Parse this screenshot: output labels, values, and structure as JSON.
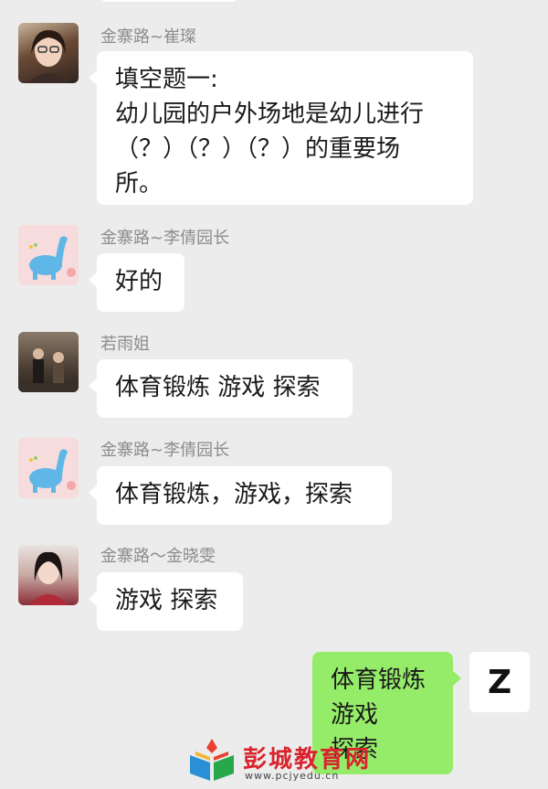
{
  "messages": [
    {
      "sender": "金寨路~崔璨",
      "text": "填空题一:\n幼儿园的户外场地是幼儿进行\n（？）（？）（？）的重要场\n所。"
    },
    {
      "sender": "金寨路~李倩园长",
      "text": "好的"
    },
    {
      "sender": "若雨姐",
      "text": "体育锻炼 游戏 探索"
    },
    {
      "sender": "金寨路~李倩园长",
      "text": "体育锻炼，游戏，探索"
    },
    {
      "sender": "金寨路～金晓雯",
      "text": "游戏 探索"
    }
  ],
  "my_message": {
    "text": "体育锻炼\n游戏\n探索",
    "avatar_letter": "Z"
  },
  "watermark": {
    "brand": "彭城教育网",
    "url": "www.pcjyedu.cn"
  },
  "colors": {
    "background": "#ececec",
    "incoming_bubble": "#ffffff",
    "outgoing_bubble": "#95ec69",
    "watermark_red": "#d9232d"
  },
  "icons": [
    "avatar-photo-woman",
    "avatar-blue-dinosaur",
    "avatar-photo-couple",
    "avatar-blue-dinosaur",
    "avatar-photo-woman-red",
    "book-logo-icon"
  ]
}
